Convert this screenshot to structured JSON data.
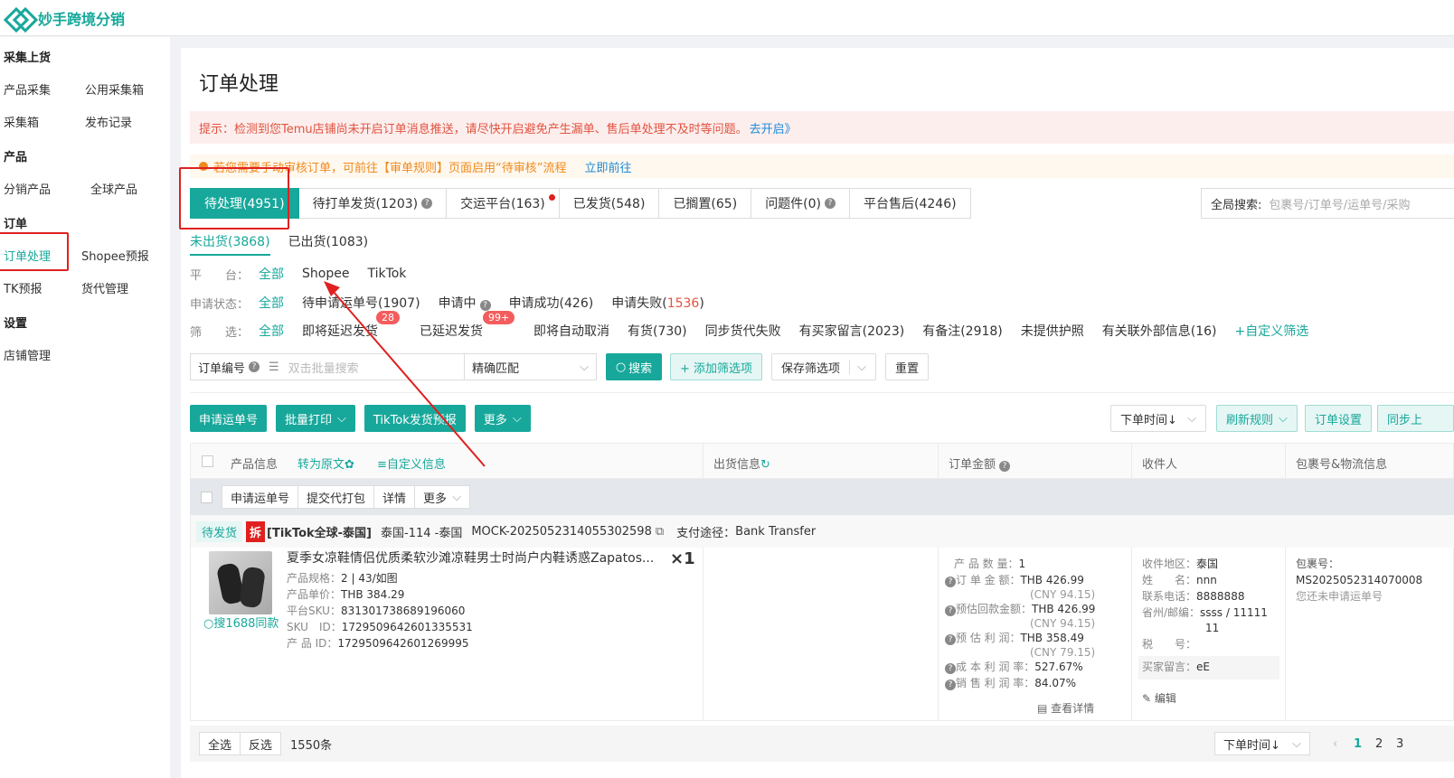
{
  "app": {
    "title": "妙手跨境分销"
  },
  "sidebar": {
    "groups": [
      {
        "title": "采集上货",
        "items": [
          "产品采集",
          "公用采集箱",
          "采集箱",
          "发布记录"
        ]
      },
      {
        "title": "产品",
        "items": [
          "分销产品",
          "全球产品"
        ]
      },
      {
        "title": "订单",
        "items": [
          "订单处理",
          "Shopee预报",
          "TK预报",
          "货代管理"
        ]
      },
      {
        "title": "设置",
        "items": [
          "店铺管理"
        ]
      }
    ]
  },
  "page": {
    "title": "订单处理",
    "notice_red": "提示：检测到您Temu店铺尚未开启订单消息推送，请尽快开启避免产生漏单、售后单处理不及时等问题。",
    "notice_red_link": "去开启》",
    "notice_orange": "若您需要手动审核订单，可前往【审单规则】页面启用“待审核”流程",
    "notice_orange_link": "立即前往",
    "tabs": [
      "待处理(4951)",
      "待打单发货(1203)",
      "交运平台(163)",
      "已发货(548)",
      "已搁置(65)",
      "问题件(0)",
      "平台售后(4246)"
    ],
    "global_search_label": "全局搜索:",
    "global_search_placeholder": "包裹号/订单号/运单号/采购",
    "subtabs": [
      "未出货(3868)",
      "已出货(1083)"
    ],
    "filters": {
      "platform_label": "平　　台：",
      "platform_options": [
        "全部",
        "Shopee",
        "TikTok"
      ],
      "apply_label": "申请状态：",
      "apply_options": [
        "全部",
        "待申请运单号(1907)",
        "申请中",
        "申请成功(426)"
      ],
      "apply_fail_prefix": "申请失败(",
      "apply_fail_count": "1536",
      "apply_fail_suffix": ")",
      "screen_label": "筛　　选：",
      "screen_options": [
        "全部",
        "即将延迟发货",
        "已延迟发货",
        "即将自动取消",
        "有货(730)",
        "同步货代失败",
        "有买家留言(2023)",
        "有备注(2918)",
        "未提供护照",
        "有关联外部信息(16)"
      ],
      "badge_soon_delay": "28",
      "badge_delayed": "99+",
      "custom_filter": "+自定义筛选"
    },
    "search": {
      "field_label": "订单编号",
      "field_placeholder": "双击批量搜索",
      "match_mode": "精确匹配",
      "search_btn": "搜索",
      "add_filter_btn": "+ 添加筛选项",
      "save_filter_btn": "保存筛选项",
      "reset_btn": "重置"
    },
    "actions": {
      "apply_waybill": "申请运单号",
      "batch_print": "批量打印",
      "tiktok_forecast": "TikTok发货预报",
      "more": "更多",
      "sort_select": "下单时间↓",
      "refresh_rule": "刷新规则",
      "order_settings": "订单设置",
      "sync": "同步上"
    },
    "table": {
      "headers": {
        "product_info": "产品信息",
        "to_original": "转为原文",
        "custom_info": "≡自定义信息",
        "ship_info": "出货信息",
        "order_amount": "订单金额",
        "receiver": "收件人",
        "package_logistics": "包裹号&物流信息"
      },
      "batch_buttons": [
        "申请运单号",
        "提交代打包",
        "详情",
        "更多"
      ]
    },
    "order": {
      "status_tag": "待发货",
      "split_tag": "拆",
      "shop": "[TikTok全球-泰国]",
      "shop_region": "泰国-114 -泰国",
      "order_no": "MOCK-2025052314055302598",
      "pay_label": "支付途径：",
      "pay_method": "Bank Transfer",
      "product_title": "夏季女凉鞋情侣优质柔软沙滩凉鞋男士时尚户内鞋诱惑Zapatos...",
      "quantity": "×1",
      "search_1688": "搜1688同款",
      "spec_label": "产品规格：",
      "spec": "2 | 43/如图",
      "price_label": "产品单价：",
      "price": "THB 384.29",
      "platform_sku_label": "平台SKU：",
      "platform_sku": "831301738689196060",
      "sku_id_label": "SKU　ID：",
      "sku_id": "1729509642601335531",
      "product_id_label": "产 品 ID：",
      "product_id": "1729509642601269995",
      "amount": {
        "qty_label": "产 品 数 量：",
        "qty": "1",
        "order_amount_label": "订 单 金 额：",
        "order_amount": "THB 426.99",
        "order_amount_cny": "(CNY 94.15)",
        "refund_label": "预估回款金额：",
        "refund": "THB 426.99",
        "refund_cny": "(CNY 94.15)",
        "profit_label": "预 估 利 润：",
        "profit": "THB 358.49",
        "profit_cny": "(CNY 79.15)",
        "cost_margin_label": "成 本 利 润 率：",
        "cost_margin": "527.67%",
        "sale_margin_label": "销 售 利 润 率：",
        "sale_margin": "84.07%",
        "view_detail": "查看详情"
      },
      "receiver": {
        "region_label": "收件地区：",
        "region": "泰国",
        "name_label": "姓　　名：",
        "name": "nnn",
        "phone_label": "联系电话：",
        "phone": "8888888",
        "province_label": "省州/邮编：",
        "province": "ssss / 11111",
        "province_cont": "11",
        "tax_label": "税　　号：",
        "tax": "",
        "buyer_msg_label": "买家留言：",
        "buyer_msg": "eE",
        "edit": "编辑"
      },
      "package": {
        "label": "包裹号：",
        "no": "MS2025052314070008",
        "waybill_note": "您还未申请运单号"
      }
    },
    "footer": {
      "select_all": "全选",
      "invert": "反选",
      "count": "1550条",
      "sort": "下单时间↓",
      "pages": [
        "1",
        "2",
        "3"
      ]
    }
  },
  "colors": {
    "brand": "#17a89b",
    "alert": "#e02020",
    "warn": "#f08a1d"
  }
}
